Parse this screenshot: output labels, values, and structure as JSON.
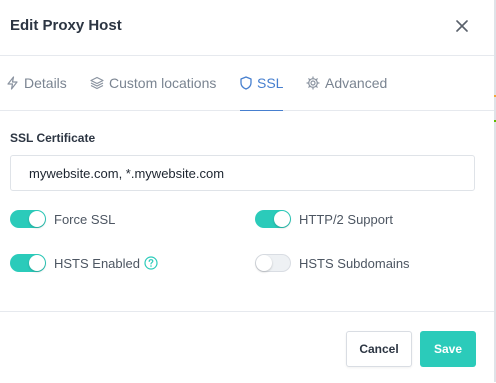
{
  "modal": {
    "title": "Edit Proxy Host",
    "close_icon": "close-icon"
  },
  "tabs": [
    {
      "label": "Details",
      "icon": "bolt-icon",
      "active": false
    },
    {
      "label": "Custom locations",
      "icon": "layers-icon",
      "active": false
    },
    {
      "label": "SSL",
      "icon": "shield-icon",
      "active": true
    },
    {
      "label": "Advanced",
      "icon": "gear-icon",
      "active": false
    }
  ],
  "ssl": {
    "section_label": "SSL Certificate",
    "certificate_value": "mywebsite.com, *.mywebsite.com",
    "toggles": {
      "force_ssl": {
        "label": "Force SSL",
        "on": true
      },
      "http2": {
        "label": "HTTP/2 Support",
        "on": true
      },
      "hsts_enabled": {
        "label": "HSTS Enabled",
        "on": true,
        "help_icon": "question-circle-icon"
      },
      "hsts_subdomains": {
        "label": "HSTS Subdomains",
        "on": false
      }
    }
  },
  "footer": {
    "cancel_label": "Cancel",
    "save_label": "Save"
  },
  "colors": {
    "accent": "#2bcbba",
    "active_tab": "#467fcf"
  }
}
